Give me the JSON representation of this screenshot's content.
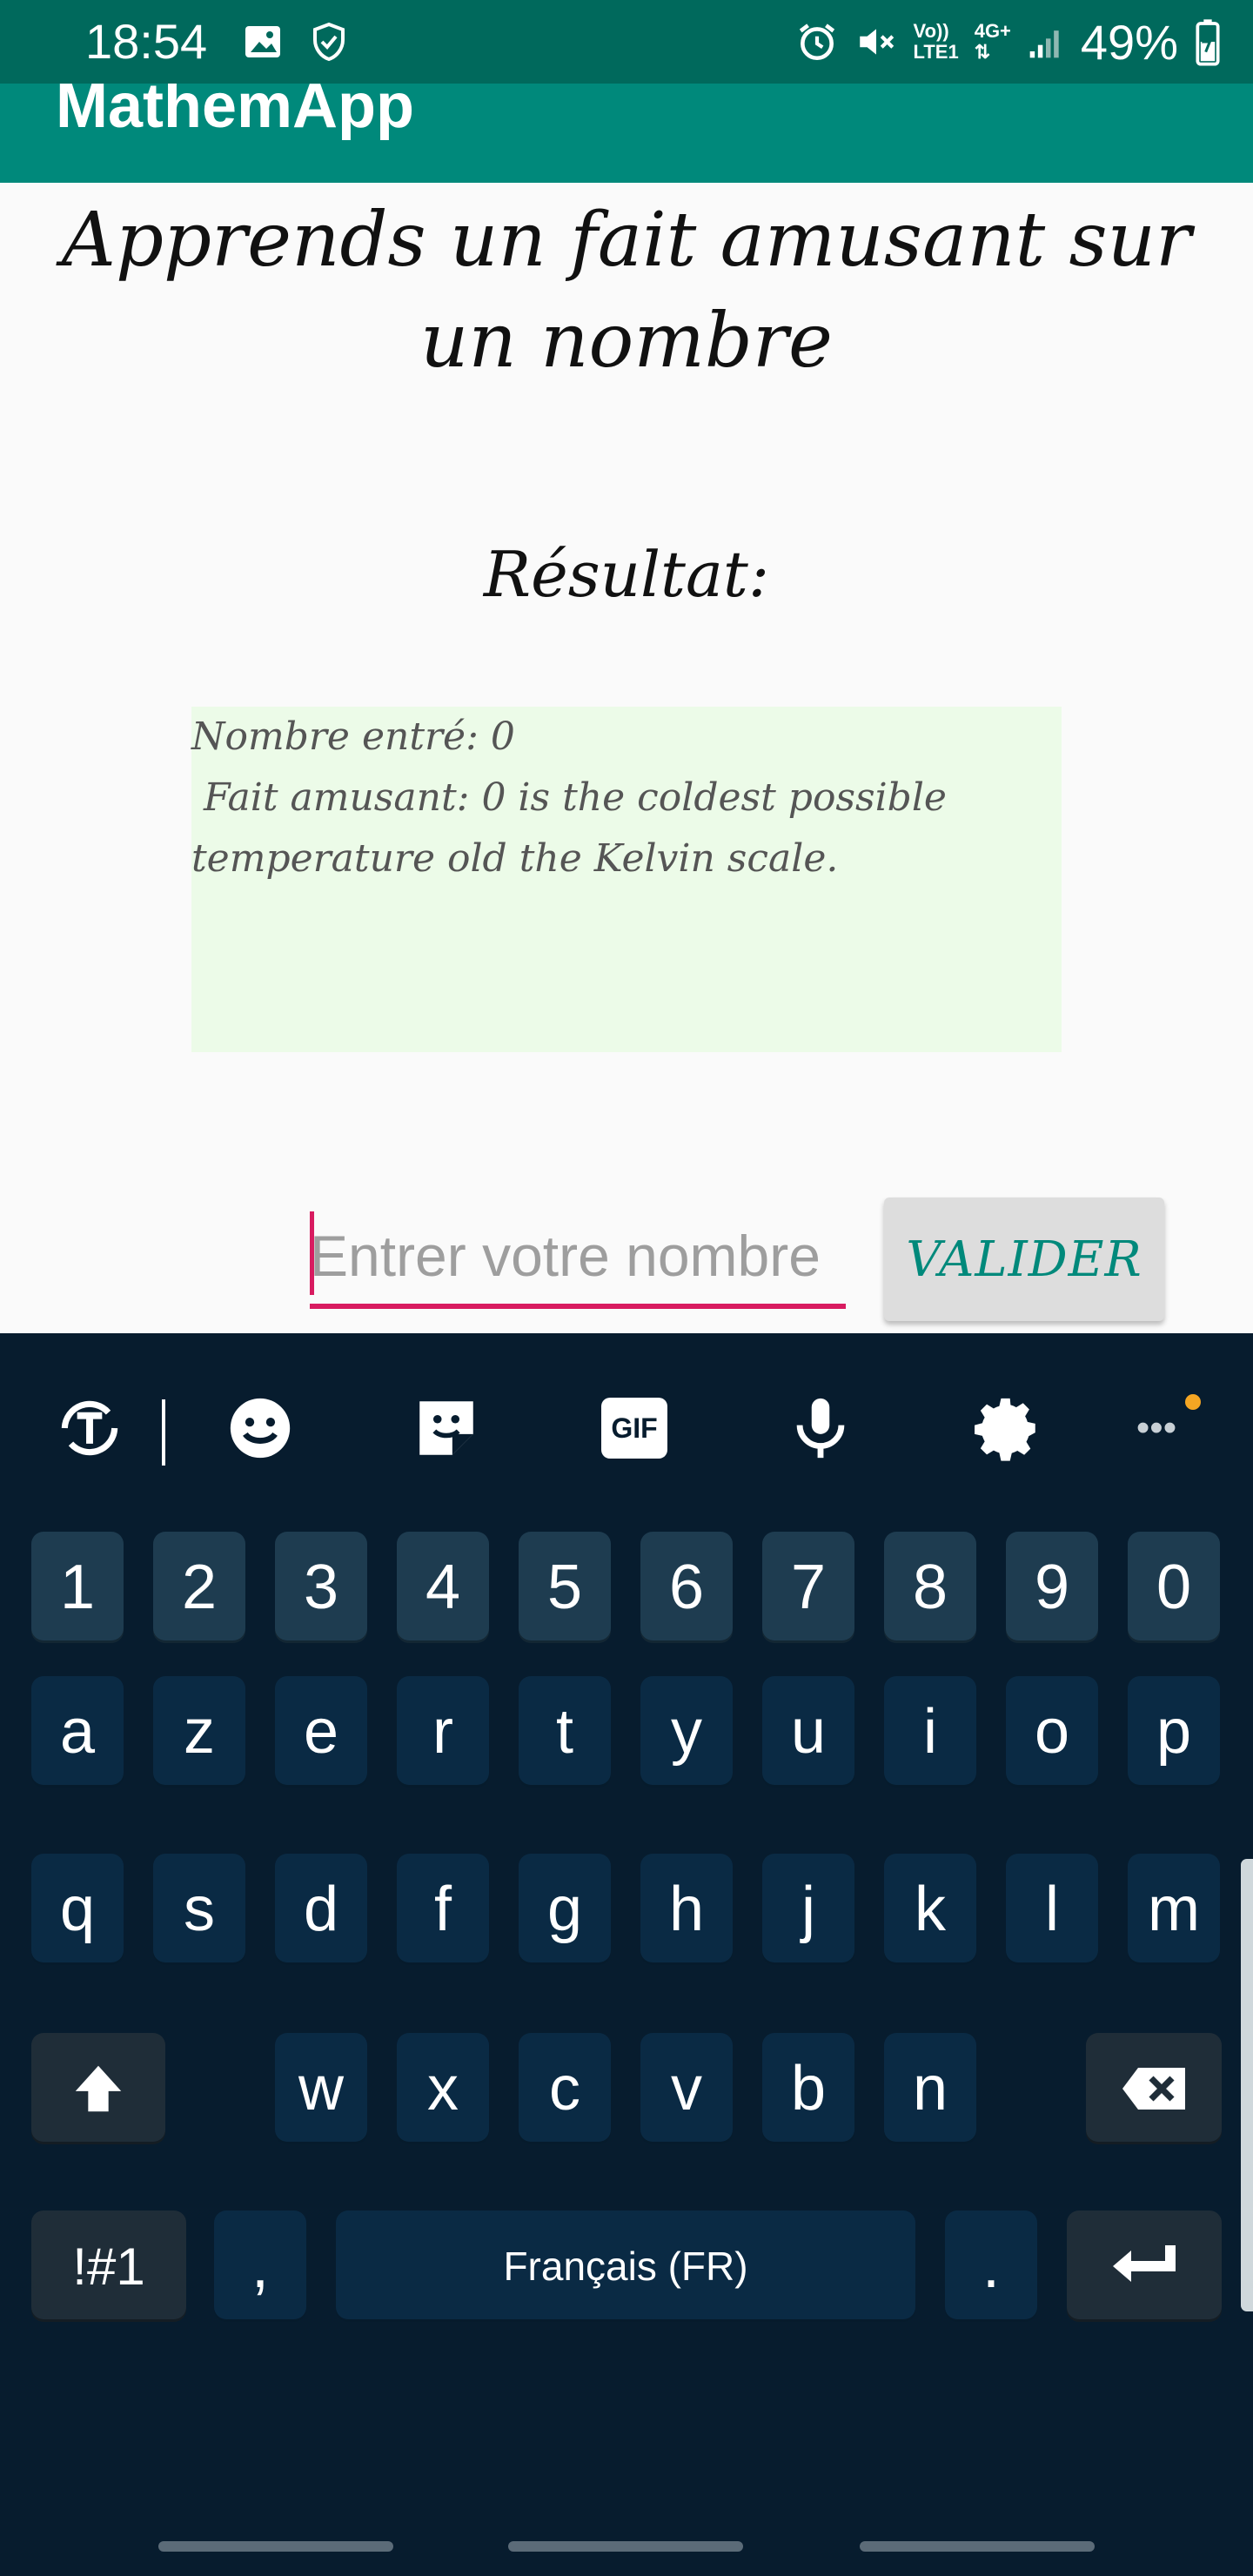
{
  "status_bar": {
    "time": "18:54",
    "net_top": "Vo))",
    "net_bottom": "LTE1",
    "net_type": "4G+",
    "battery": "49%",
    "icons": [
      "image-icon",
      "shield-icon",
      "alarm-icon",
      "mute-icon",
      "signal-icon",
      "battery-charging-icon"
    ]
  },
  "app_bar": {
    "title": "MathemApp",
    "color": "#00897b"
  },
  "main": {
    "heading": "Apprends un fait amusant sur un nombre",
    "result_label": "Résultat:",
    "result_text": "Nombre entré: 0\n Fait amusant: 0 is the coldest possible temperature old the Kelvin scale.",
    "input_placeholder": "Entrer votre nombre",
    "input_value": "",
    "validate_label": "VALIDER",
    "result_box_color": "#ecfbe8",
    "accent_color": "#d81b60"
  },
  "keyboard": {
    "toolbar_icons": [
      "text-translate-icon",
      "emoji-icon",
      "sticker-icon",
      "gif-icon",
      "microphone-icon",
      "settings-icon",
      "more-icon"
    ],
    "gif_label": "GIF",
    "more_label": "•••",
    "row1": [
      "1",
      "2",
      "3",
      "4",
      "5",
      "6",
      "7",
      "8",
      "9",
      "0"
    ],
    "row2": [
      "a",
      "z",
      "e",
      "r",
      "t",
      "y",
      "u",
      "i",
      "o",
      "p"
    ],
    "row3": [
      "q",
      "s",
      "d",
      "f",
      "g",
      "h",
      "j",
      "k",
      "l",
      "m"
    ],
    "row4": [
      "w",
      "x",
      "c",
      "v",
      "b",
      "n"
    ],
    "symbols_label": "!#1",
    "comma_label": ",",
    "space_label": "Français (FR)",
    "period_label": ".",
    "background": "#071c2e"
  }
}
